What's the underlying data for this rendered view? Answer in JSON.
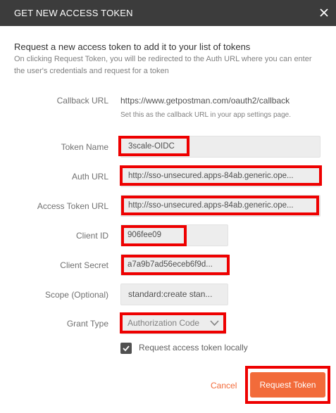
{
  "dialog": {
    "title": "GET NEW ACCESS TOKEN"
  },
  "intro": {
    "heading": "Request a new access token to add it to your list of tokens",
    "description": "On clicking Request Token, you will be redirected to the Auth URL where you can enter the user's credentials and request for a token"
  },
  "form": {
    "callback": {
      "label": "Callback URL",
      "value": "https://www.getpostman.com/oauth2/callback",
      "hint": "Set this as the callback URL in your app settings page."
    },
    "token_name": {
      "label": "Token Name",
      "value": "3scale-OIDC"
    },
    "auth_url": {
      "label": "Auth URL",
      "value": "http://sso-unsecured.apps-84ab.generic.ope..."
    },
    "access_token_url": {
      "label": "Access Token URL",
      "value": "http://sso-unsecured.apps-84ab.generic.ope..."
    },
    "client_id": {
      "label": "Client ID",
      "value": "906fee09"
    },
    "client_secret": {
      "label": "Client Secret",
      "value": "a7a9b7ad56eceb6f9d..."
    },
    "scope": {
      "label": "Scope (Optional)",
      "value": "standard:create stan..."
    },
    "grant_type": {
      "label": "Grant Type",
      "value": "Authorization Code"
    },
    "request_locally": {
      "label": "Request access token locally",
      "checked": true
    }
  },
  "buttons": {
    "cancel": "Cancel",
    "request": "Request Token"
  },
  "colors": {
    "title_bar": "#3c3c3c",
    "accent": "#f26b3a",
    "highlight": "#ee0000"
  },
  "icons": {
    "close": "close-icon",
    "dropdown": "chevron-down-icon",
    "checkbox": "checkmark-icon"
  }
}
